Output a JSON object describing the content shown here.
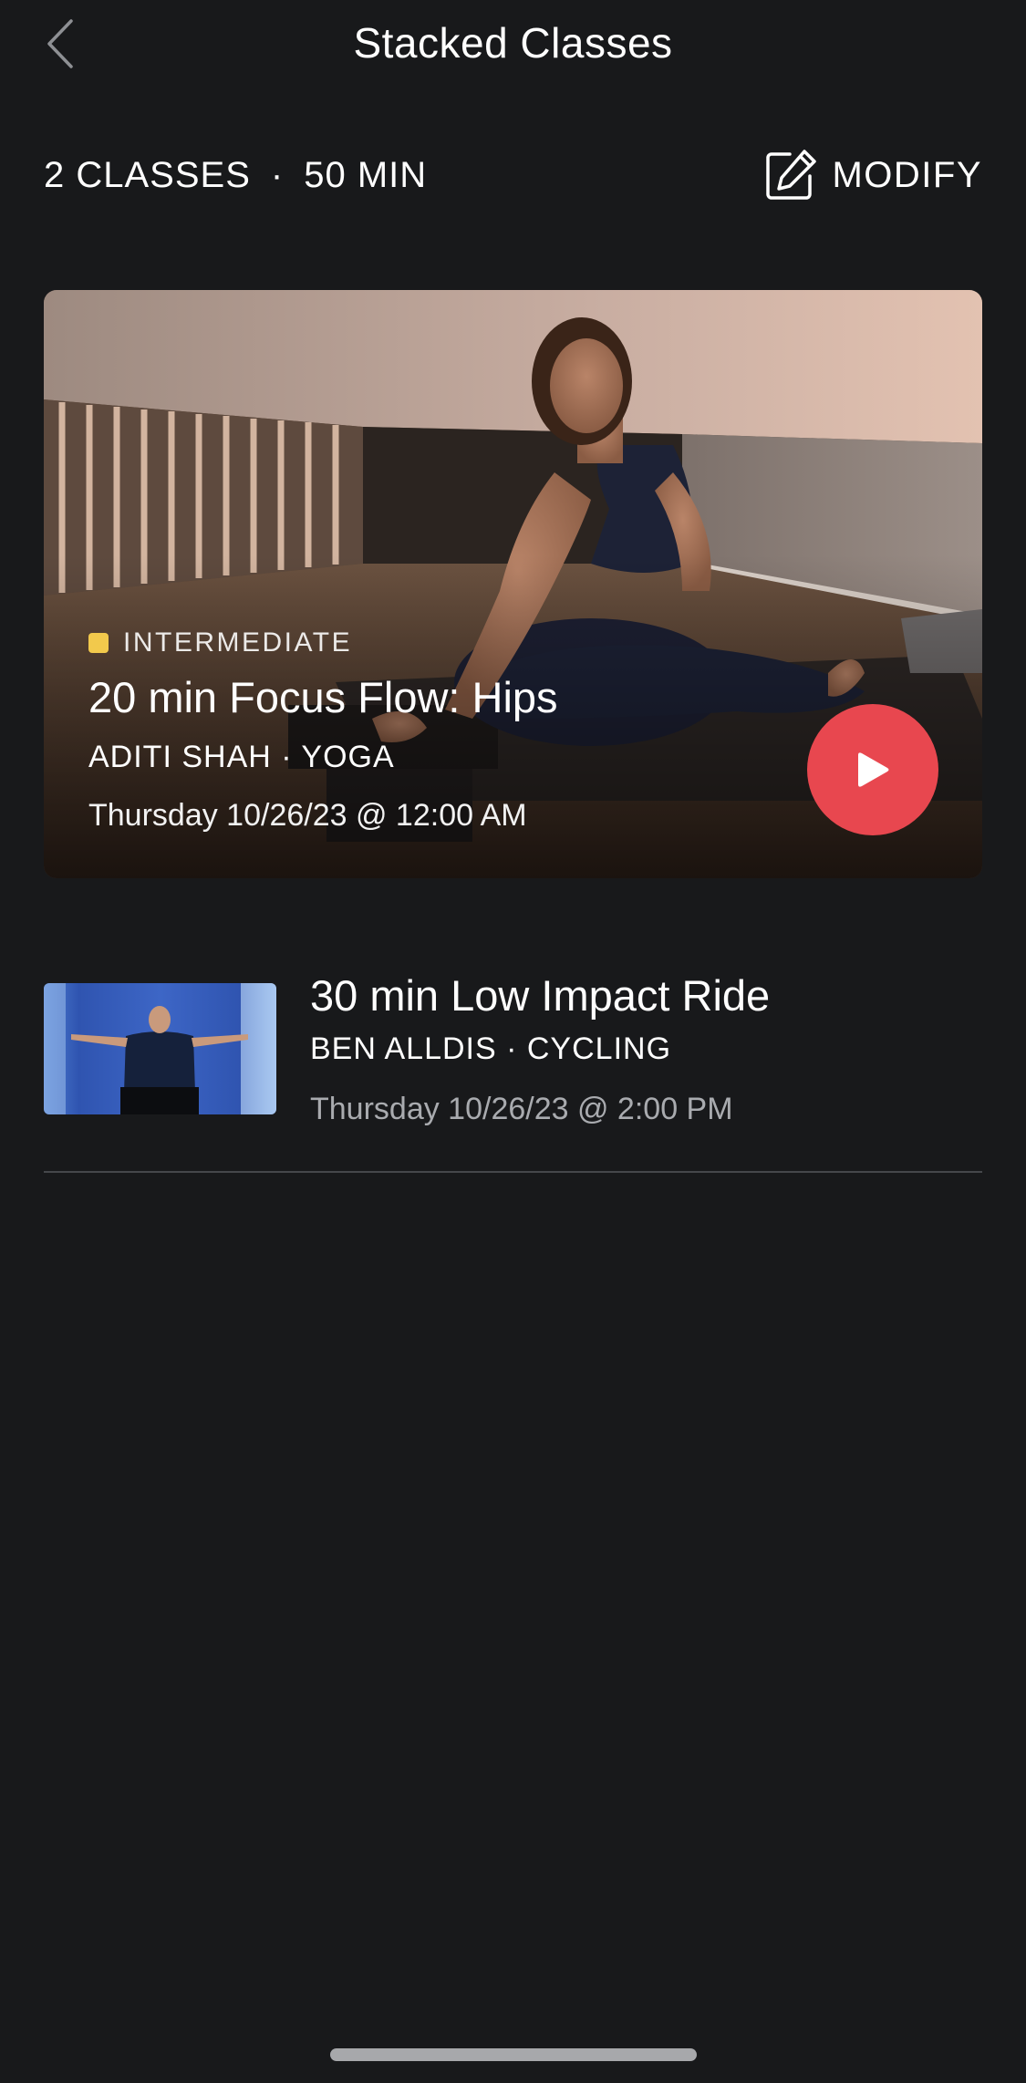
{
  "header": {
    "title": "Stacked Classes",
    "back_icon": "chevron-left-icon"
  },
  "summary": {
    "classes": "2 CLASSES",
    "separator": "·",
    "duration": "50 MIN",
    "modify_label": "MODIFY",
    "modify_icon": "edit-icon"
  },
  "classes": [
    {
      "difficulty": "INTERMEDIATE",
      "difficulty_color": "#f2c94c",
      "title": "20 min Focus Flow: Hips",
      "meta": "ADITI SHAH · YOGA",
      "time": "Thursday 10/26/23 @ 12:00 AM",
      "play_icon": "play-icon"
    },
    {
      "title": "30 min Low Impact Ride",
      "meta": "BEN ALLDIS · CYCLING",
      "time": "Thursday 10/26/23 @ 2:00 PM"
    }
  ],
  "colors": {
    "background": "#18191b",
    "play_button": "#e8474f",
    "secondary_text": "#a9abaf"
  }
}
